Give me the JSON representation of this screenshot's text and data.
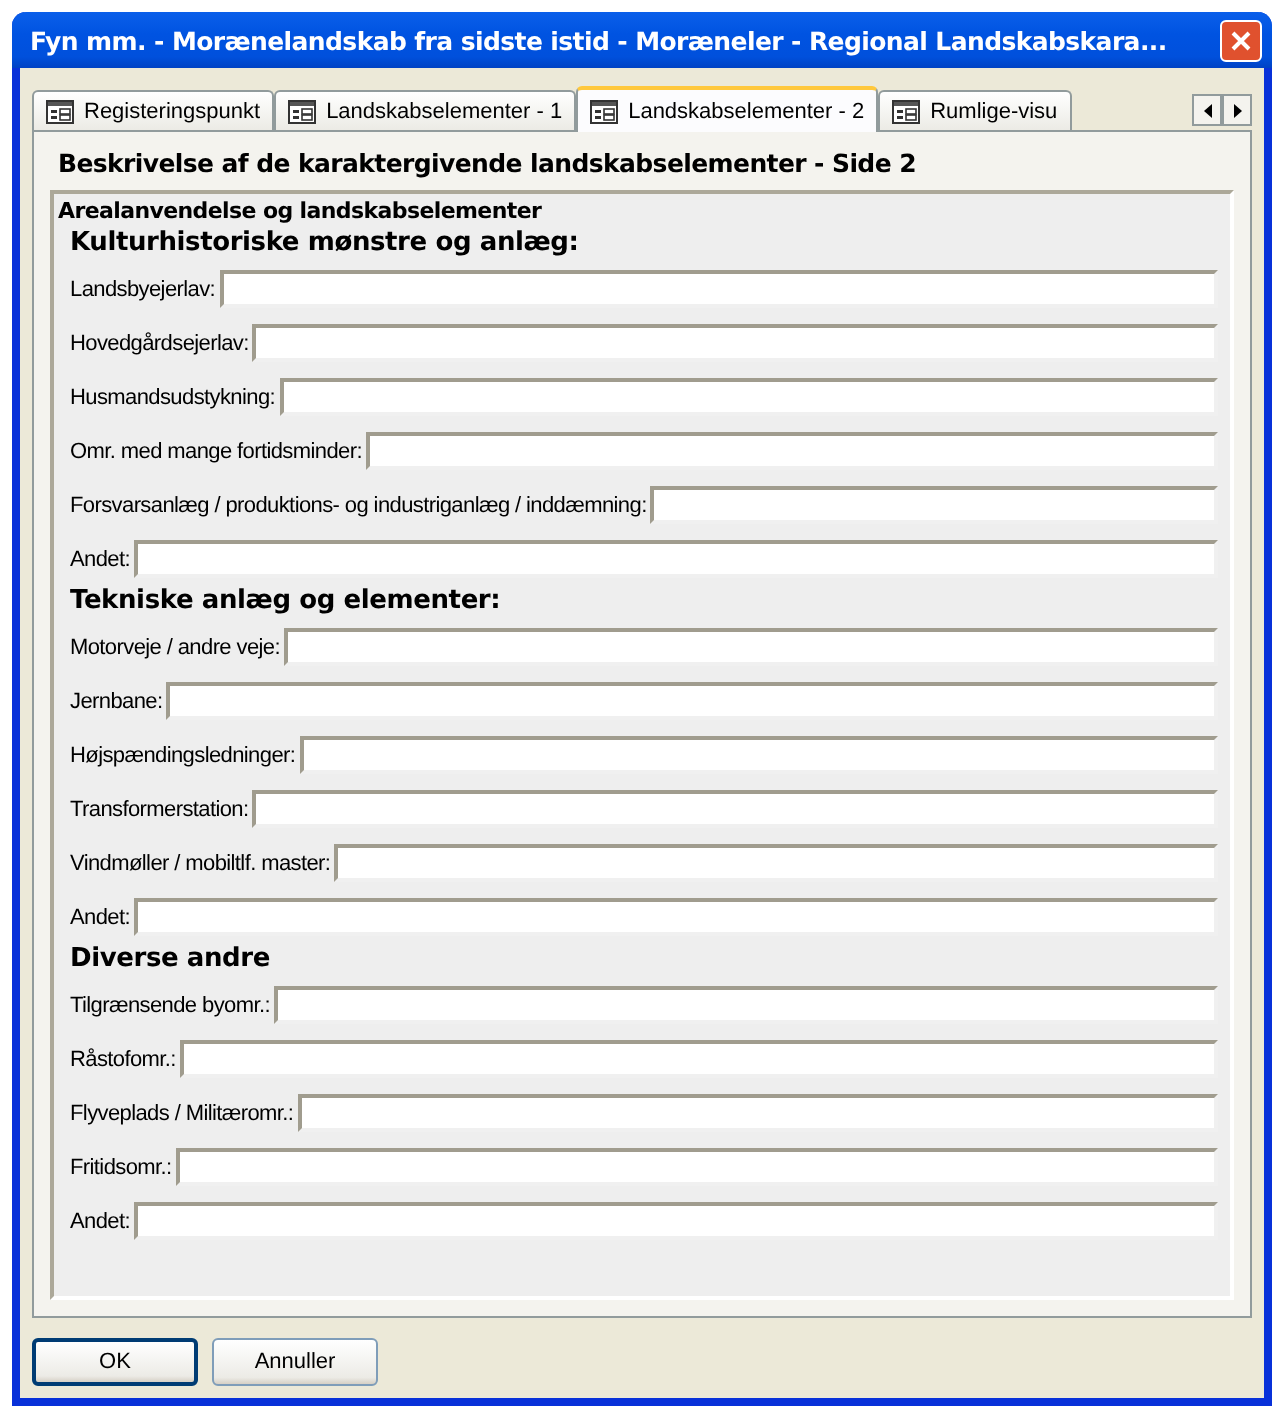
{
  "window": {
    "title": "Fyn mm. - Morænelandskab fra sidste istid - Moræneler - Regional Landskabskara..."
  },
  "tabs": [
    {
      "label": "Registeringspunkt",
      "selected": false
    },
    {
      "label": "Landskabselementer - 1",
      "selected": false
    },
    {
      "label": "Landskabselementer - 2",
      "selected": true
    },
    {
      "label": "Rumlige-visu",
      "selected": false
    }
  ],
  "page_heading": "Beskrivelse af de karaktergivende landskabselementer - Side 2",
  "group": {
    "title": "Arealanvendelse og landskabselementer",
    "sections": [
      {
        "heading": "Kulturhistoriske mønstre og anlæg:",
        "fields": [
          {
            "label": "Landsbyejerlav:"
          },
          {
            "label": "Hovedgårdsejerlav:"
          },
          {
            "label": "Husmandsudstykning:"
          },
          {
            "label": "Omr. med mange fortidsminder:"
          },
          {
            "label": "Forsvarsanlæg / produktions- og industriganlæg / inddæmning:"
          },
          {
            "label": "Andet:"
          }
        ]
      },
      {
        "heading": "Tekniske anlæg og elementer:",
        "fields": [
          {
            "label": "Motorveje / andre veje:"
          },
          {
            "label": "Jernbane:"
          },
          {
            "label": "Højspændingsledninger:"
          },
          {
            "label": "Transformerstation:"
          },
          {
            "label": "Vindmøller / mobiltlf. master:"
          },
          {
            "label": "Andet:"
          }
        ]
      },
      {
        "heading": "Diverse andre",
        "fields": [
          {
            "label": "Tilgrænsende byomr.:"
          },
          {
            "label": "Råstofomr.:"
          },
          {
            "label": "Flyveplads / Militæromr.:"
          },
          {
            "label": "Fritidsomr.:"
          },
          {
            "label": "Andet:"
          }
        ]
      }
    ]
  },
  "buttons": [
    {
      "label": "OK",
      "default": true
    },
    {
      "label": "Annuller",
      "default": false
    }
  ]
}
